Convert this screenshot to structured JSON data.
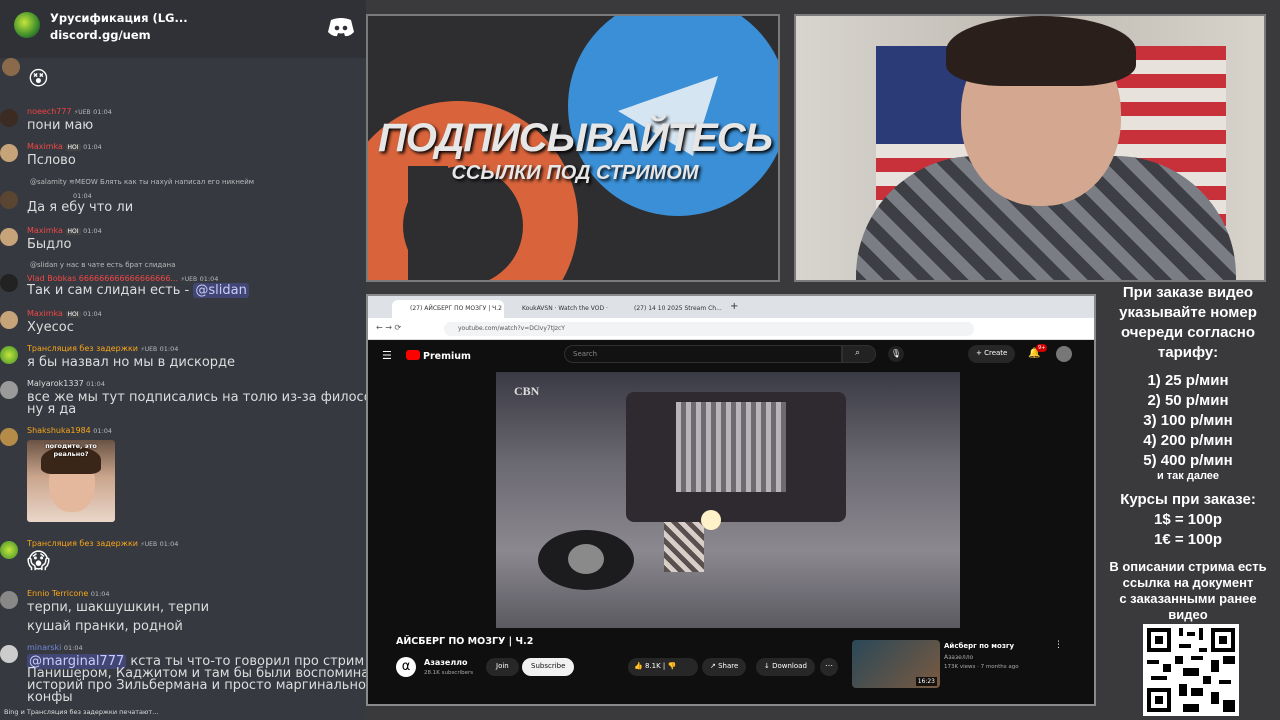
{
  "discord": {
    "server_name": "Урусификация (LG...",
    "invite": "discord.gg/uem",
    "typing": "Bing и Трансляция без задержки печатают..."
  },
  "messages": [
    {
      "user": "noeech777",
      "badge": "⚡UEB",
      "time": "01:04",
      "text": "пони маю",
      "color": "#ed4245"
    },
    {
      "user": "Maximka",
      "badge": "HOI",
      "time": "01:04",
      "text": "Пслово",
      "color": "#f04747"
    },
    {
      "reply": "@salamity ≋MEOW Блять как ты нахуй написал его никнейм",
      "user": "",
      "badge": "",
      "time": "01:04",
      "text": "Да я ебу что ли",
      "color": "#b9bbbe"
    },
    {
      "user": "Maximka",
      "badge": "HOI",
      "time": "01:04",
      "text": "Быдло",
      "color": "#f04747"
    },
    {
      "reply": "@slidan у нас в чате есть брат слидана",
      "user": "Vlad Bobkas 666666666666666666...",
      "badge": "⚡UEB",
      "time": "01:04",
      "text": "Так и сам слидан есть - ",
      "mention": "@slidan",
      "color": "#f04747"
    },
    {
      "user": "Maximka",
      "badge": "HOI",
      "time": "01:04",
      "text": "Хуесос",
      "color": "#f04747"
    },
    {
      "user": "Трансляция без задержки",
      "badge": "⚡UEB",
      "time": "01:04",
      "text": "я бы назвал но мы в дискорде",
      "color": "#faa61a"
    },
    {
      "user": "Malyarok1337",
      "badge": "",
      "time": "01:04",
      "text": "все же мы тут подписались на толю из-за философии.",
      "text2": "ну я да",
      "color": "#dcddde"
    },
    {
      "user": "Shakshuka1984",
      "badge": "",
      "time": "01:04",
      "image_caption": "погодите, это реально?",
      "color": "#faa61a"
    },
    {
      "user": "Трансляция без задержки",
      "badge": "⚡UEB",
      "time": "01:04",
      "emoji": "😱",
      "color": "#faa61a"
    },
    {
      "user": "Ennio Terricone",
      "badge": "",
      "time": "01:04",
      "text": "терпи, шакшушкин, терпи",
      "text2": "кушай пранки, родной",
      "color": "#faa61a"
    },
    {
      "user": "minarski",
      "badge": "",
      "time": "01:04",
      "mention": "@marginal777",
      "text": " кста ты что-то говорил про стрим с",
      "text2": "Панишером, Каджитом и там бы были воспоминанием",
      "text3": "историй про Зильбермана и просто маргинальной",
      "text4": "конфы",
      "color": "#7289da"
    }
  ],
  "promo": {
    "line1": "ПОДПИСЫВАЙТЕСЬ",
    "line2": "ССЫЛКИ ПОД СТРИМОМ"
  },
  "browser": {
    "tabs": [
      "(27) АЙСБЕРГ ПО МОЗГУ | Ч.2",
      "KoukAVSN · Watch the VOD ·",
      "(27) 14 10 2025 Stream Ch..."
    ],
    "url": "youtube.com/watch?v=DCIvy7tJzcY"
  },
  "youtube": {
    "logo": "Premium",
    "search_placeholder": "Search",
    "create": "Create",
    "notif_count": "9+",
    "video_title": "АЙСБЕРГ ПО МОЗГУ | Ч.2",
    "channel": "Азазелло",
    "subscribers": "28.1K subscribers",
    "join": "Join",
    "subscribe": "Subscribe",
    "likes": "8.1K",
    "share": "Share",
    "download": "Download",
    "rec": {
      "title": "Айсберг по мозгу",
      "channel": "Азазелло",
      "meta": "173K views · 7 months ago",
      "duration": "16:23"
    },
    "watermark": "CBN"
  },
  "sidebar": {
    "l1": "При заказе видео",
    "l2": "указывайте номер",
    "l3": "очереди согласно",
    "l4": "тарифу:",
    "t1": "1) 25 р/мин",
    "t2": "2) 50 р/мин",
    "t3": "3) 100 р/мин",
    "t4": "4) 200 р/мин",
    "t5": "5) 400 р/мин",
    "t6": "и так далее",
    "c1": "Курсы при заказе:",
    "c2": "1$ = 100р",
    "c3": "1€ = 100р",
    "d1": "В описании стрима есть",
    "d2": "ссылка на документ",
    "d3": "с заказанными ранее",
    "d4": "видео"
  }
}
